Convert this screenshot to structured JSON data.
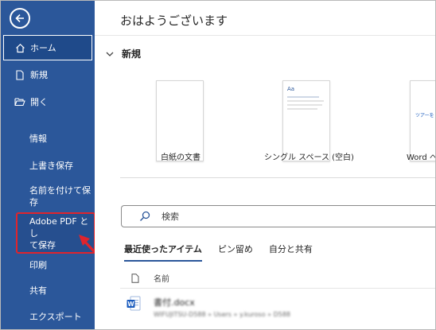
{
  "sidebar": {
    "items": [
      {
        "label": "ホーム"
      },
      {
        "label": "新規"
      },
      {
        "label": "開く"
      },
      {
        "label": "情報"
      },
      {
        "label": "上書き保存"
      },
      {
        "label": "名前を付けて保\n存"
      },
      {
        "label": "Adobe PDF とし\nて保存"
      },
      {
        "label": "印刷"
      },
      {
        "label": "共有"
      },
      {
        "label": "エクスポート"
      }
    ]
  },
  "main": {
    "greeting": "おはようございます",
    "new_section": "新規",
    "templates": [
      {
        "label": "白紙の文書"
      },
      {
        "label": "シングル スペース (空白)",
        "thumb_text": "Aa"
      },
      {
        "label": "Word へ",
        "thumb_text": "ツアーを"
      }
    ],
    "search_placeholder": "検索",
    "tabs": [
      {
        "label": "最近使ったアイテム"
      },
      {
        "label": "ピン留め"
      },
      {
        "label": "自分と共有"
      }
    ],
    "column_name": "名前",
    "files": [
      {
        "name": "書付.docx",
        "path": "WIFUJITSU-D588 » Users » y.kuroso » D588"
      }
    ]
  },
  "colors": {
    "sidebar": "#2b579a",
    "highlight": "#e0242c",
    "word_blue": "#185abd"
  }
}
